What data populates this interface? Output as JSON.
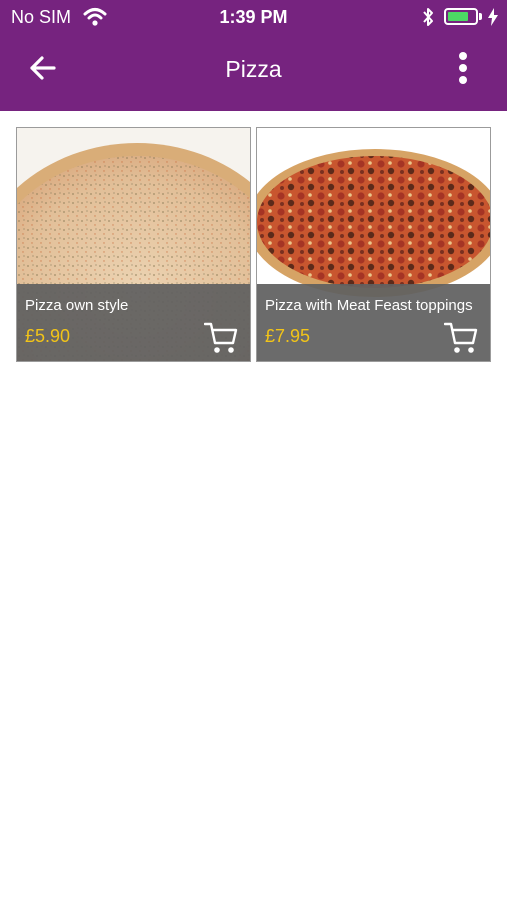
{
  "status_bar": {
    "carrier": "No SIM",
    "time": "1:39 PM",
    "battery_level": 0.75,
    "icons": [
      "wifi-icon",
      "bluetooth-icon",
      "battery-icon",
      "charging-bolt-icon"
    ]
  },
  "app_bar": {
    "title": "Pizza",
    "back_icon": "arrow-left-icon",
    "menu_icon": "more-vertical-icon",
    "color": "#76237f"
  },
  "products": [
    {
      "name": "Pizza own style",
      "price": "£5.90",
      "image": "plain-cheese-pizza",
      "cart_icon": "cart-icon"
    },
    {
      "name": "Pizza with Meat Feast toppings",
      "price": "£7.95",
      "image": "meat-feast-pizza",
      "cart_icon": "cart-icon"
    }
  ],
  "colors": {
    "price": "#f2c418",
    "overlay": "#606060",
    "battery": "#4cd964"
  }
}
